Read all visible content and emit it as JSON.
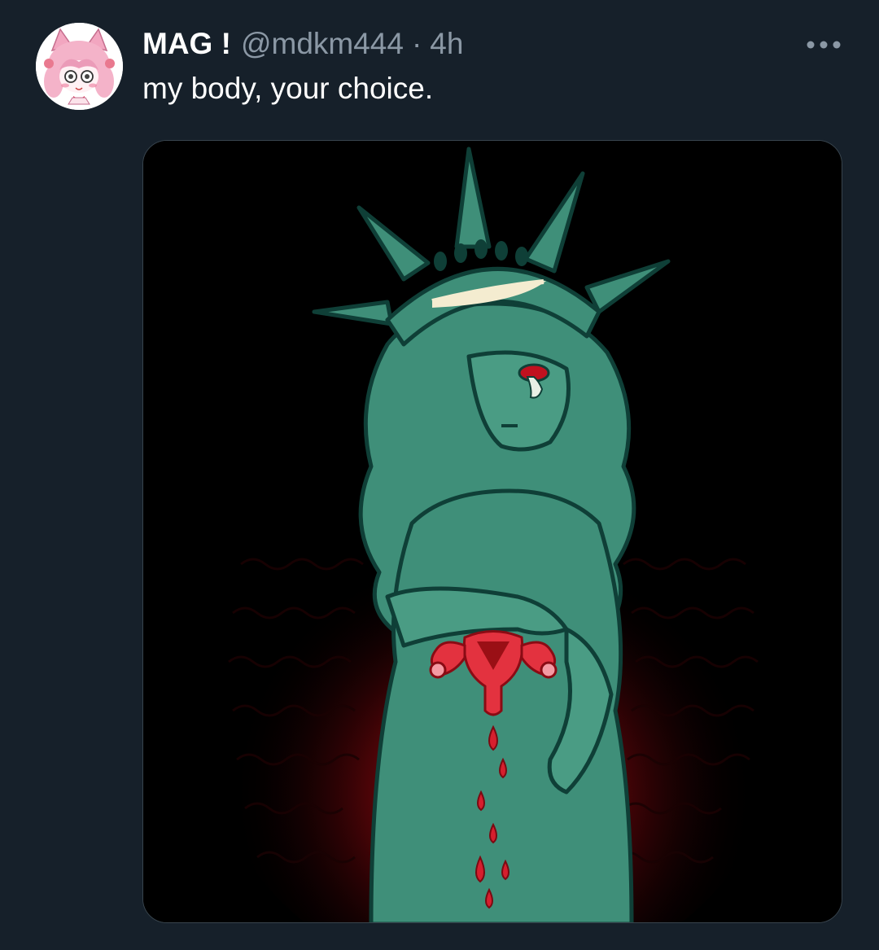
{
  "tweet": {
    "author": {
      "display_name": "MAG !",
      "handle": "@mdkm444",
      "avatar_icon": "anime-girl-avatar-icon"
    },
    "separator": "·",
    "timestamp": "4h",
    "text": "my body, your choice.",
    "more_icon": "more-horizontal-icon",
    "media": {
      "kind": "illustration",
      "subject": "weeping-statue-of-liberty-art"
    }
  },
  "colors": {
    "background": "#16202a",
    "primary_text": "#ffffff",
    "secondary_text": "#8b98a5",
    "statue_green": "#3f8f79",
    "statue_outline": "#0f3f37",
    "blood_red": "#d61f2e"
  }
}
